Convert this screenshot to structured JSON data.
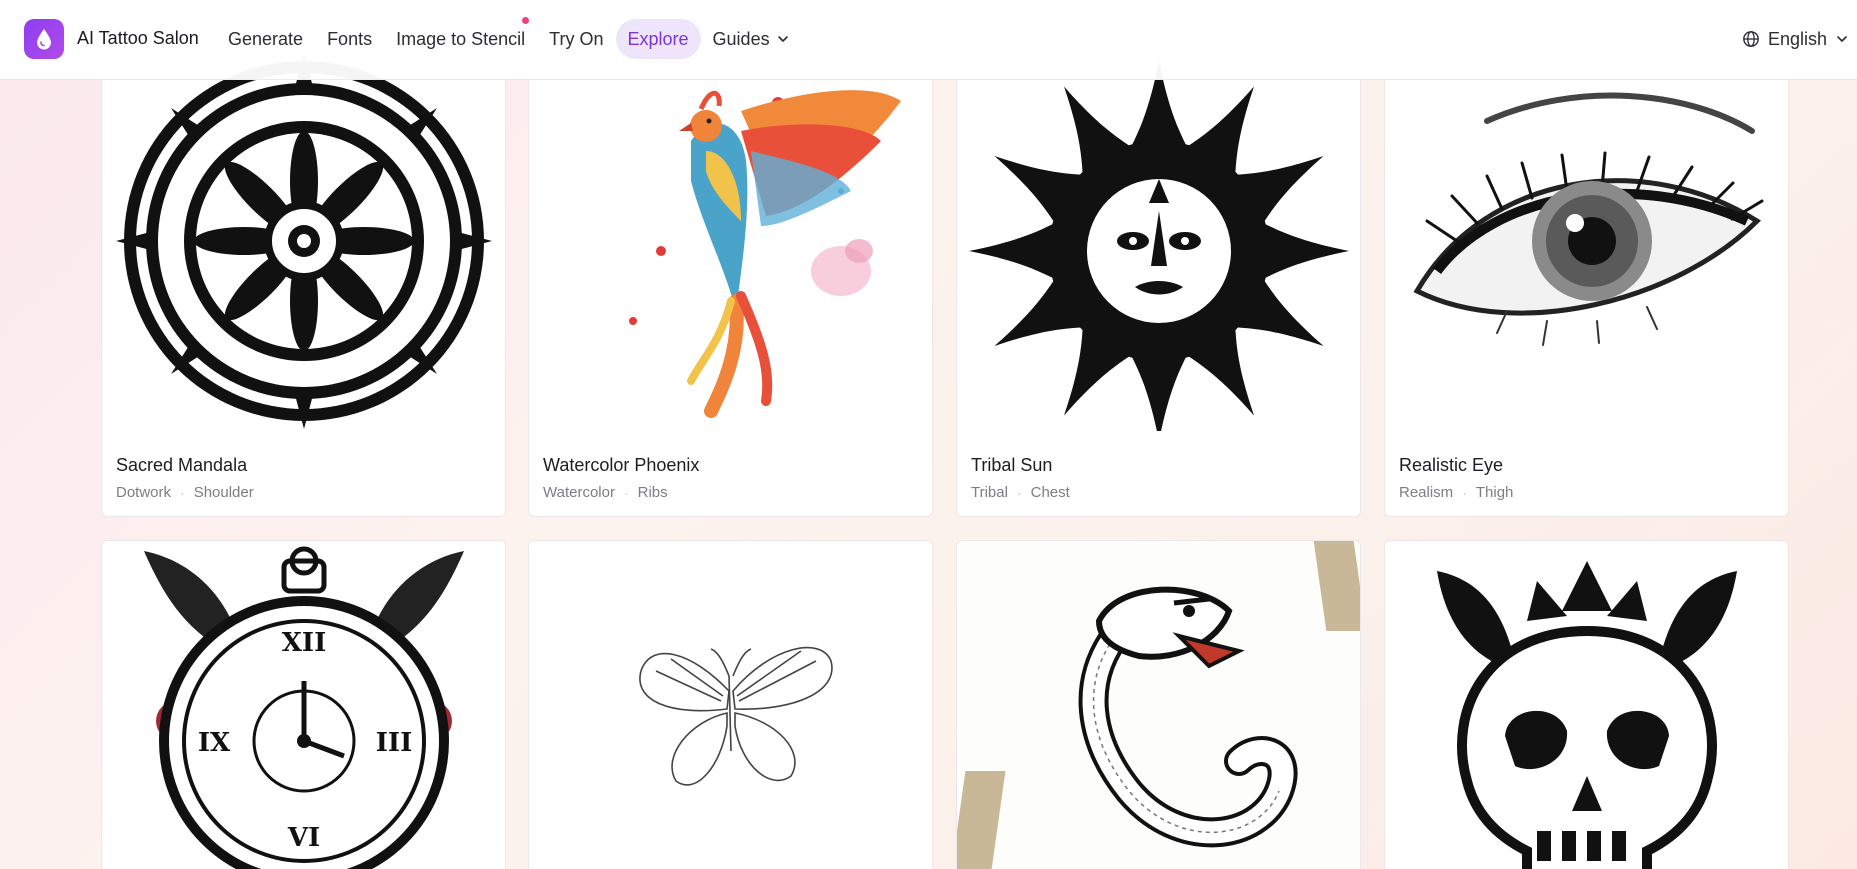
{
  "brand": {
    "name": "AI Tattoo Salon",
    "logo_icon": "ink-drop-icon",
    "logo_color": "#8b3ff0"
  },
  "nav": {
    "items": [
      {
        "label": "Generate"
      },
      {
        "label": "Fonts"
      },
      {
        "label": "Image to Stencil"
      },
      {
        "label": "Try On"
      },
      {
        "label": "Explore"
      },
      {
        "label": "Guides"
      }
    ],
    "active": "Explore",
    "accent": "#7a35d8"
  },
  "language": {
    "label": "English"
  },
  "gallery": [
    {
      "title": "Sacred Mandala",
      "style": "Dotwork",
      "placement": "Shoulder",
      "art": "mandala"
    },
    {
      "title": "Watercolor Phoenix",
      "style": "Watercolor",
      "placement": "Ribs",
      "art": "phoenix"
    },
    {
      "title": "Tribal Sun",
      "style": "Tribal",
      "placement": "Chest",
      "art": "sun"
    },
    {
      "title": "Realistic Eye",
      "style": "Realism",
      "placement": "Thigh",
      "art": "eye"
    },
    {
      "art": "clock"
    },
    {
      "art": "butterfly"
    },
    {
      "art": "snake"
    },
    {
      "art": "skull"
    }
  ]
}
